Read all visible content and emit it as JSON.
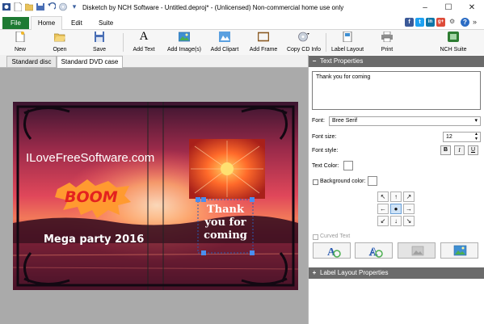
{
  "window": {
    "title": "Disketch by NCH Software - Untitled.deproj* - (Unlicensed) Non-commercial home use only",
    "controls": {
      "minimize": "–",
      "maximize": "☐",
      "close": "✕"
    }
  },
  "ribbon": {
    "tabs": [
      "File",
      "Home",
      "Edit",
      "Suite"
    ],
    "social": [
      "f",
      "t",
      "in",
      "g+"
    ],
    "help": "?",
    "collapse": "»"
  },
  "toolbar": {
    "new": "New",
    "open": "Open",
    "save": "Save",
    "add_text": "Add Text",
    "add_images": "Add Image(s)",
    "add_clipart": "Add Clipart",
    "add_frame": "Add Frame",
    "copy_cd_info": "Copy CD Info",
    "label_layout": "Label Layout",
    "print": "Print",
    "nch_suite": "NCH Suite",
    "text_glyph": "A"
  },
  "doc_tabs": [
    "Standard disc",
    "Standard DVD case"
  ],
  "canvas": {
    "watermark": "ILoveFreeSoftware.com",
    "boom": "BOOM",
    "party": "Mega party 2016",
    "thank_lines": [
      "Thank",
      "you for",
      "coming"
    ]
  },
  "text_properties": {
    "header": "Text Properties",
    "text_value": "Thank you for coming",
    "font_label": "Font:",
    "font_value": "Bree Serif",
    "size_label": "Font size:",
    "size_value": "12",
    "style_label": "Font style:",
    "style_bold": "B",
    "style_italic": "I",
    "style_underline": "U",
    "text_color_label": "Text Color:",
    "bg_color_label": "Background color:",
    "curved_label": "Curved Text",
    "align_arrows": [
      "↖",
      "↑",
      "↗",
      "←",
      "●",
      "→",
      "↙",
      "↓",
      "↘"
    ]
  },
  "label_layout": {
    "header": "Label Layout Properties"
  },
  "colors": {
    "file_tab": "#1e7a33",
    "section_header": "#6b6b6b",
    "canvas_bg": "#aaaaaa",
    "handle": "#4a8ef0"
  }
}
